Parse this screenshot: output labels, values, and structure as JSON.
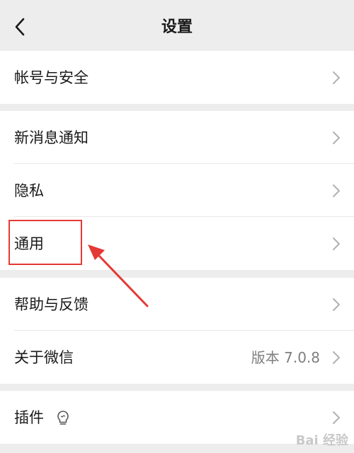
{
  "header": {
    "title": "设置",
    "back_icon": "chevron-left-icon"
  },
  "groups": [
    {
      "items": [
        {
          "label": "帐号与安全"
        }
      ]
    },
    {
      "items": [
        {
          "label": "新消息通知"
        },
        {
          "label": "隐私"
        },
        {
          "label": "通用"
        }
      ]
    },
    {
      "items": [
        {
          "label": "帮助与反馈"
        },
        {
          "label": "关于微信",
          "value": "版本 7.0.8"
        }
      ]
    },
    {
      "items": [
        {
          "label": "插件",
          "icon": "lightbulb-icon"
        }
      ]
    }
  ],
  "annotation": {
    "color": "#e53935",
    "target": "通用"
  },
  "watermark": {
    "text": "Bai 经验"
  }
}
